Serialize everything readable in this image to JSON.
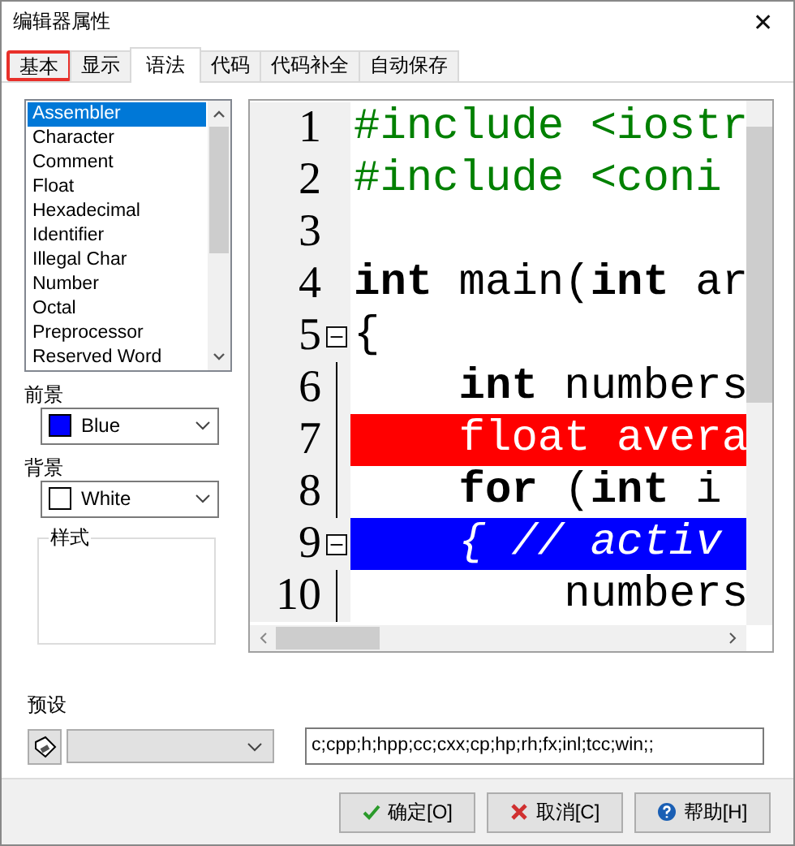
{
  "window": {
    "title": "编辑器属性",
    "close": "✕"
  },
  "tabs": [
    {
      "label": "基本",
      "selected": false,
      "highlighted": true
    },
    {
      "label": "显示",
      "selected": false,
      "highlighted": false
    },
    {
      "label": "语法",
      "selected": true,
      "highlighted": false
    },
    {
      "label": "代码",
      "selected": false,
      "highlighted": false
    },
    {
      "label": "代码补全",
      "selected": false,
      "highlighted": false
    },
    {
      "label": "自动保存",
      "selected": false,
      "highlighted": false
    }
  ],
  "element_list": [
    {
      "label": "Assembler",
      "selected": true
    },
    {
      "label": "Character",
      "selected": false
    },
    {
      "label": "Comment",
      "selected": false
    },
    {
      "label": "Float",
      "selected": false
    },
    {
      "label": "Hexadecimal",
      "selected": false
    },
    {
      "label": "Identifier",
      "selected": false
    },
    {
      "label": "Illegal Char",
      "selected": false
    },
    {
      "label": "Number",
      "selected": false
    },
    {
      "label": "Octal",
      "selected": false
    },
    {
      "label": "Preprocessor",
      "selected": false
    },
    {
      "label": "Reserved Word",
      "selected": false
    }
  ],
  "foreground": {
    "label": "前景",
    "value": "Blue",
    "color": "#0000ff"
  },
  "background": {
    "label": "背景",
    "value": "White",
    "color": "#ffffff"
  },
  "style_group": {
    "label": "样式"
  },
  "code_preview": [
    {
      "number": "1",
      "fold": false,
      "segments": [
        {
          "kind": "preproc",
          "text": "#include <iostr"
        }
      ]
    },
    {
      "number": "2",
      "fold": false,
      "segments": [
        {
          "kind": "preproc",
          "text": "#include <coni"
        }
      ]
    },
    {
      "number": "3",
      "fold": false
    },
    {
      "number": "4",
      "fold": false,
      "segments": [
        {
          "kind": "keyword",
          "text": "int"
        },
        {
          "kind": "normal",
          "text": " main("
        },
        {
          "kind": "keyword",
          "text": "int"
        },
        {
          "kind": "normal",
          "text": " ar"
        }
      ]
    },
    {
      "number": "5",
      "fold": true,
      "segments": [
        {
          "kind": "normal",
          "text": "{"
        }
      ]
    },
    {
      "number": "6",
      "fold": false,
      "segments": [
        {
          "kind": "keyword",
          "text": "    int"
        },
        {
          "kind": "normal",
          "text": " numbers"
        }
      ]
    },
    {
      "number": "7",
      "fold": false,
      "color": "#ff0000",
      "segments": [
        {
          "kind": "normal",
          "text": "    float avera"
        }
      ]
    },
    {
      "number": "8",
      "fold": false,
      "segments": [
        {
          "kind": "keyword",
          "text": "    for"
        },
        {
          "kind": "normal",
          "text": " ("
        },
        {
          "kind": "keyword",
          "text": "int"
        },
        {
          "kind": "normal",
          "text": " i"
        }
      ]
    },
    {
      "number": "9",
      "fold": true,
      "color": "#0000ff",
      "segments": [
        {
          "kind": "comment",
          "text": "    { // activ"
        }
      ]
    },
    {
      "number": "10",
      "fold": false,
      "segments": [
        {
          "kind": "normal",
          "text": "        numbers"
        }
      ]
    }
  ],
  "preset": {
    "label": "预设",
    "extensions": "c;cpp;h;hpp;cc;cxx;cp;hp;rh;fx;inl;tcc;win;;"
  },
  "buttons": [
    {
      "kind": "ok",
      "label": "确定[O]"
    },
    {
      "kind": "cancel",
      "label": "取消[C]"
    },
    {
      "kind": "help",
      "label": "帮助[H]"
    }
  ]
}
